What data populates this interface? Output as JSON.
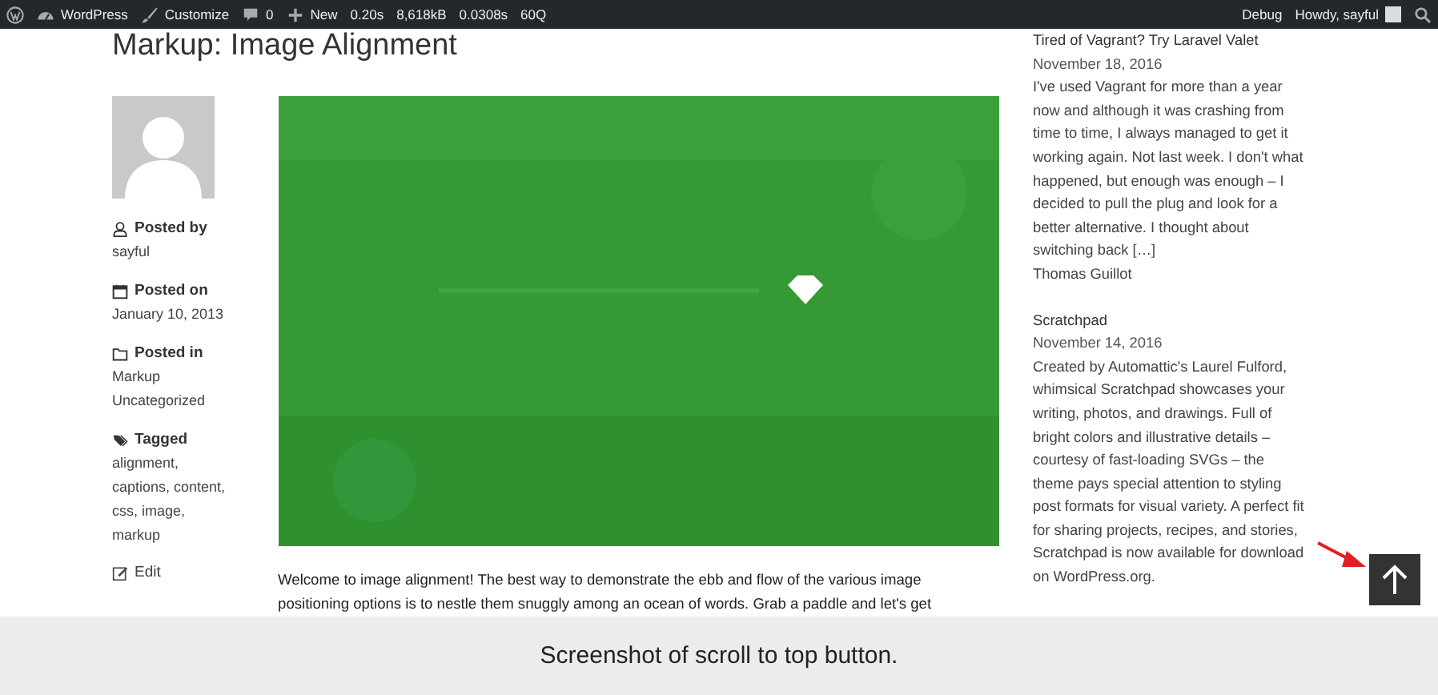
{
  "admin_bar": {
    "left": [
      {
        "kind": "wp"
      },
      {
        "kind": "site",
        "label": "WordPress"
      },
      {
        "kind": "brush",
        "label": "Customize"
      },
      {
        "kind": "comment",
        "label": "0"
      },
      {
        "kind": "plus",
        "label": "New"
      },
      {
        "kind": "text",
        "label": "0.20s"
      },
      {
        "kind": "text",
        "label": "8,618kB"
      },
      {
        "kind": "text",
        "label": "0.0308s"
      },
      {
        "kind": "text",
        "label": "60Q"
      }
    ],
    "right": [
      {
        "kind": "text",
        "label": "Debug"
      },
      {
        "kind": "avatar",
        "label": "Howdy, sayful"
      },
      {
        "kind": "search"
      }
    ]
  },
  "post": {
    "title": "Markup: Image Alignment",
    "meta": [
      {
        "kind": "user",
        "heading": "Posted by",
        "lines": [
          "sayful"
        ]
      },
      {
        "kind": "calendar",
        "heading": "Posted on",
        "lines": [
          "January 10, 2013"
        ]
      },
      {
        "kind": "folder",
        "heading": "Posted in",
        "lines": [
          "Markup",
          "Uncategorized"
        ]
      },
      {
        "kind": "tag",
        "heading": "Tagged",
        "lines": [
          "alignment,",
          "captions, content,",
          "css, image,",
          "markup"
        ]
      }
    ],
    "edit": "Edit",
    "image": {
      "kind": "picture"
    },
    "body": [
      "Welcome to image alignment! The best way to demonstrate the ebb and flow of the various image",
      "positioning options is to nestle them snuggly among an ocean of words. Grab a paddle and let's get"
    ]
  },
  "sidebar": {
    "entries": [
      {
        "title": "Tired of Vagrant? Try Laravel Valet",
        "date": "November 18, 2016",
        "text": "I've used Vagrant for more than a year now and although it was crashing from time to time, I always managed to get it working again. Not last week. I don't what happened, but enough was enough – I decided to pull the plug and look for a better alternative. I thought about switching back […]",
        "author": "Thomas Guillot"
      },
      {
        "title": "Scratchpad",
        "date": "November 14, 2016",
        "text": "Created by Automattic's Laurel Fulford, whimsical Scratchpad showcases your writing, photos, and drawings. Full of bright colors and illustrative details – courtesy of fast-loading SVGs – the theme pays special attention to styling post formats for visual variety. A perfect fit for sharing projects, recipes, and stories, Scratchpad is now available for download on WordPress.org."
      }
    ]
  },
  "caption": "Screenshot of scroll to top button."
}
